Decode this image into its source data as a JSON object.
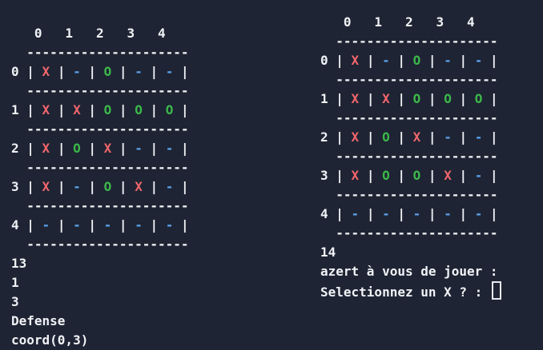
{
  "colors": {
    "background": "#1e2433",
    "text": "#f0f2f6",
    "X": "#f2666c",
    "O": "#3bb84a",
    "dash": "#5aa0e8"
  },
  "left_board": {
    "header": "   0   1   2   3   4",
    "separator": "  ---------------------",
    "rows": [
      {
        "label": "0",
        "cells": [
          "X",
          "-",
          "O",
          "-",
          "-"
        ]
      },
      {
        "label": "1",
        "cells": [
          "X",
          "X",
          "O",
          "O",
          "O"
        ]
      },
      {
        "label": "2",
        "cells": [
          "X",
          "O",
          "X",
          "-",
          "-"
        ]
      },
      {
        "label": "3",
        "cells": [
          "X",
          "-",
          "O",
          "X",
          "-"
        ]
      },
      {
        "label": "4",
        "cells": [
          "-",
          "-",
          "-",
          "-",
          "-"
        ]
      }
    ]
  },
  "left_log": [
    "13",
    "1",
    "3",
    "Defense",
    "coord(0,3)"
  ],
  "right_board": {
    "header": "   0   1   2   3   4",
    "separator": "  ---------------------",
    "rows": [
      {
        "label": "0",
        "cells": [
          "X",
          "-",
          "O",
          "-",
          "-"
        ]
      },
      {
        "label": "1",
        "cells": [
          "X",
          "X",
          "O",
          "O",
          "O"
        ]
      },
      {
        "label": "2",
        "cells": [
          "X",
          "O",
          "X",
          "-",
          "-"
        ]
      },
      {
        "label": "3",
        "cells": [
          "X",
          "O",
          "O",
          "X",
          "-"
        ]
      },
      {
        "label": "4",
        "cells": [
          "-",
          "-",
          "-",
          "-",
          "-"
        ]
      }
    ]
  },
  "right_log": [
    "14",
    "azert à vous de jouer :"
  ],
  "prompt": "Selectionnez un X ? : ",
  "cursor_icon": "block-cursor"
}
